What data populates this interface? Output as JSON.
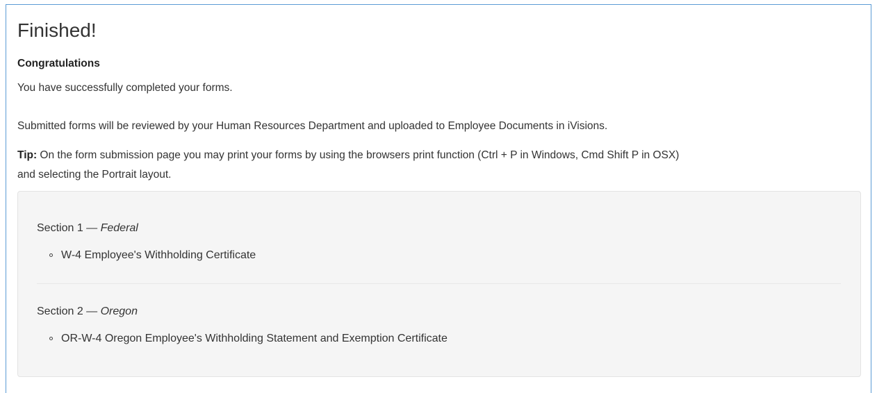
{
  "page": {
    "title": "Finished!",
    "subtitle": "Congratulations",
    "completed_text": "You have successfully completed your forms.",
    "review_text": "Submitted forms will be reviewed by your Human Resources Department and uploaded to Employee Documents in iVisions.",
    "tip_label": "Tip:",
    "tip_text": " On the form submission page you may print your forms by using the browsers print function (Ctrl + P in Windows, Cmd Shift P in OSX)",
    "tip_text_2": "and selecting the Portrait layout."
  },
  "sections": [
    {
      "prefix": "Section 1 — ",
      "name": "Federal",
      "items": [
        "W-4 Employee's Withholding Certificate"
      ]
    },
    {
      "prefix": "Section 2 — ",
      "name": "Oregon",
      "items": [
        "OR-W-4 Oregon Employee's Withholding Statement and Exemption Certificate"
      ]
    }
  ],
  "colors": {
    "frame_border": "#5b9bd5",
    "well_background": "#f5f5f5",
    "text": "#333333"
  }
}
